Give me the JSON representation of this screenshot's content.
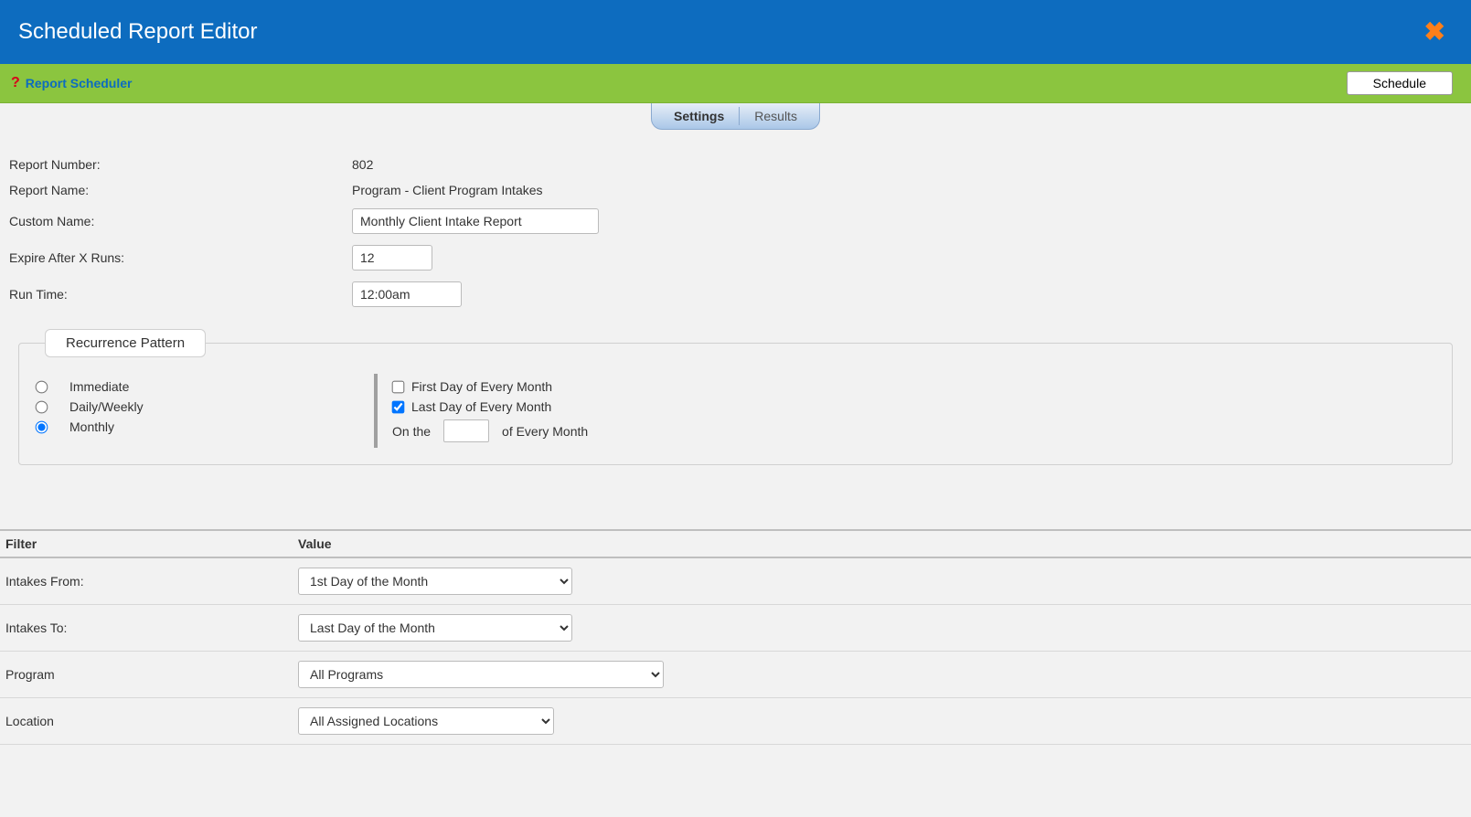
{
  "header": {
    "title": "Scheduled Report Editor"
  },
  "toolbar": {
    "help_icon": "?",
    "scheduler_link": "Report Scheduler",
    "schedule_button": "Schedule"
  },
  "tabs": {
    "settings": "Settings",
    "results": "Results"
  },
  "form": {
    "report_number_label": "Report Number:",
    "report_number_value": "802",
    "report_name_label": "Report Name:",
    "report_name_value": "Program - Client Program Intakes",
    "custom_name_label": "Custom Name:",
    "custom_name_value": "Monthly Client Intake Report",
    "expire_runs_label": "Expire After X Runs:",
    "expire_runs_value": "12",
    "run_time_label": "Run Time:",
    "run_time_value": "12:00am"
  },
  "recurrence": {
    "legend": "Recurrence Pattern",
    "left": {
      "immediate": "Immediate",
      "daily_weekly": "Daily/Weekly",
      "monthly": "Monthly"
    },
    "right": {
      "first_day": "First Day of Every Month",
      "last_day": "Last Day of Every Month",
      "on_the_pre": "On the",
      "on_the_post": "of Every Month",
      "day_value": ""
    }
  },
  "filters": {
    "head_filter": "Filter",
    "head_value": "Value",
    "rows": [
      {
        "label": "Intakes From:",
        "value": "1st Day of the Month"
      },
      {
        "label": "Intakes To:",
        "value": "Last Day of the Month"
      },
      {
        "label": "Program",
        "value": "All Programs"
      },
      {
        "label": "Location",
        "value": "All Assigned Locations"
      }
    ]
  }
}
